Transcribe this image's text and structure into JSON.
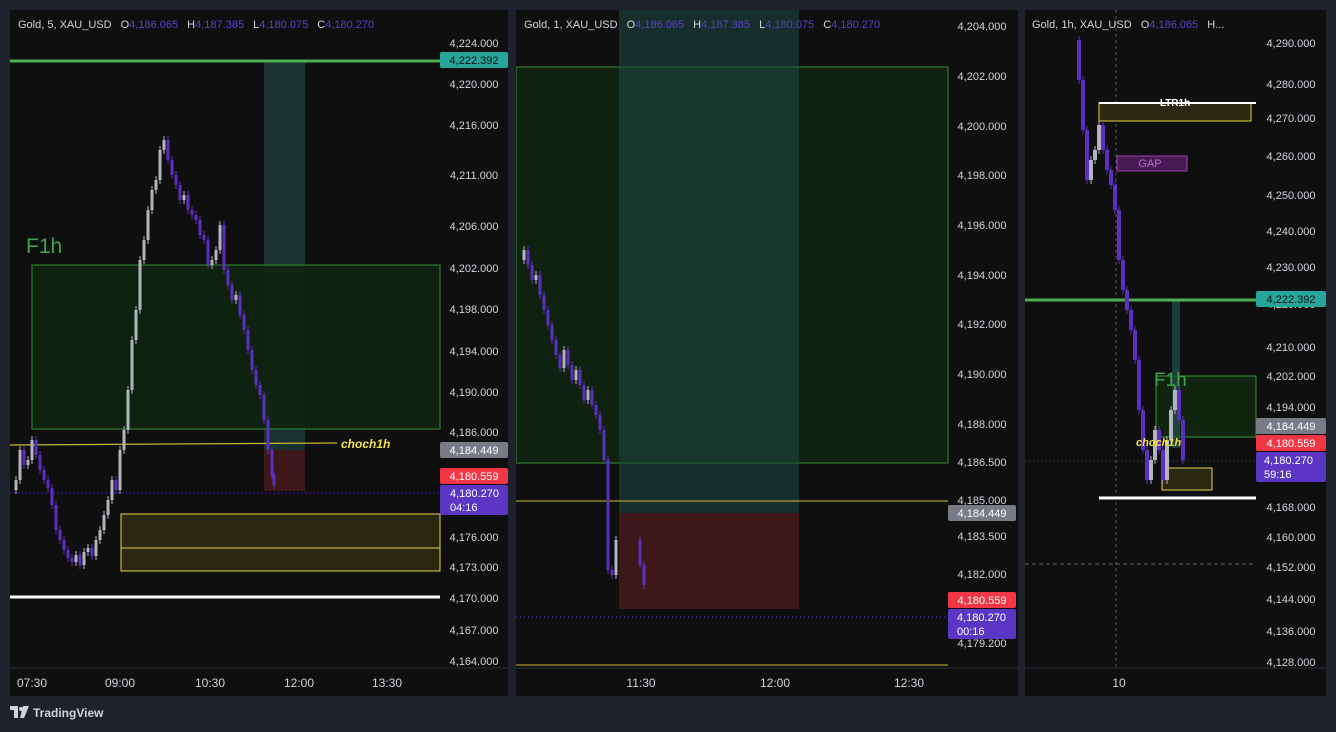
{
  "panes": [
    {
      "id": "left",
      "legend": {
        "symbol": "Gold, 5, XAU_USD",
        "o_label": "O",
        "o": "4,186.065",
        "h_label": "H",
        "h": "4,187.385",
        "l_label": "L",
        "l": "4,180.075",
        "c_label": "C",
        "c": "4,180.270"
      },
      "y_ticks": [
        "4,224.000",
        "4,220.000",
        "4,216.000",
        "4,211.000",
        "4,206.000",
        "4,202.000",
        "4,198.000",
        "4,194.000",
        "4,190.000",
        "4,186.000",
        "4,176.000",
        "4,173.000",
        "4,170.000",
        "4,167.000",
        "4,164.000"
      ],
      "x_ticks": [
        "07:30",
        "09:00",
        "10:30",
        "12:00",
        "13:30"
      ],
      "price_tags": {
        "level": "4,222.392",
        "gray": "4,184.449",
        "red": "4,180.559",
        "last": "4,180.270",
        "countdown": "04:16"
      },
      "annotations": {
        "zone": "F1h",
        "choch": "choch1h"
      }
    },
    {
      "id": "middle",
      "legend": {
        "symbol": "Gold, 1, XAU_USD",
        "o_label": "O",
        "o": "4,186.065",
        "h_label": "H",
        "h": "4,187.385",
        "l_label": "L",
        "l": "4,180.075",
        "c_label": "C",
        "c": "4,180.270"
      },
      "y_ticks": [
        "4,204.000",
        "4,202.000",
        "4,200.000",
        "4,198.000",
        "4,196.000",
        "4,194.000",
        "4,192.000",
        "4,190.000",
        "4,188.000",
        "4,186.500",
        "4,185.000",
        "4,183.500",
        "4,182.000",
        "4,179.200"
      ],
      "x_ticks": [
        "11:30",
        "12:00",
        "12:30"
      ],
      "price_tags": {
        "gray": "4,184.449",
        "red": "4,180.559",
        "last": "4,180.270",
        "countdown": "00:16"
      }
    },
    {
      "id": "right",
      "legend": {
        "symbol": "Gold, 1h, XAU_USD",
        "o_label": "O",
        "o": "4,186.065",
        "more": "H..."
      },
      "y_ticks": [
        "4,290.000",
        "4,280.000",
        "4,270.000",
        "4,260.000",
        "4,250.000",
        "4,240.000",
        "4,230.000",
        "4,220.000",
        "4,210.000",
        "4,202.000",
        "4,194.000",
        "4,168.000",
        "4,160.000",
        "4,152.000",
        "4,144.000",
        "4,136.000",
        "4,128.000"
      ],
      "x_ticks": [
        "10"
      ],
      "price_tags": {
        "level": "4,222.392",
        "gray": "4,184.449",
        "red": "4,180.559",
        "last": "4,180.270",
        "countdown": "59:16"
      },
      "annotations": {
        "ltr": "LTR1h",
        "gap": "GAP",
        "zone": "F1h",
        "choch": "choch1h"
      }
    }
  ],
  "footer": {
    "brand": "TradingView",
    "logo_icon": "tradingview-logo-icon"
  },
  "colors": {
    "bull": "#b2b5be",
    "bear": "#5d2fc1",
    "green_line": "#4caf50",
    "teal_tag": "#26a69a",
    "red_tag": "#f23645",
    "purple_tag": "#5b35c4",
    "yellow": "#f0e04a",
    "legend_value": "#5a3fd0"
  }
}
